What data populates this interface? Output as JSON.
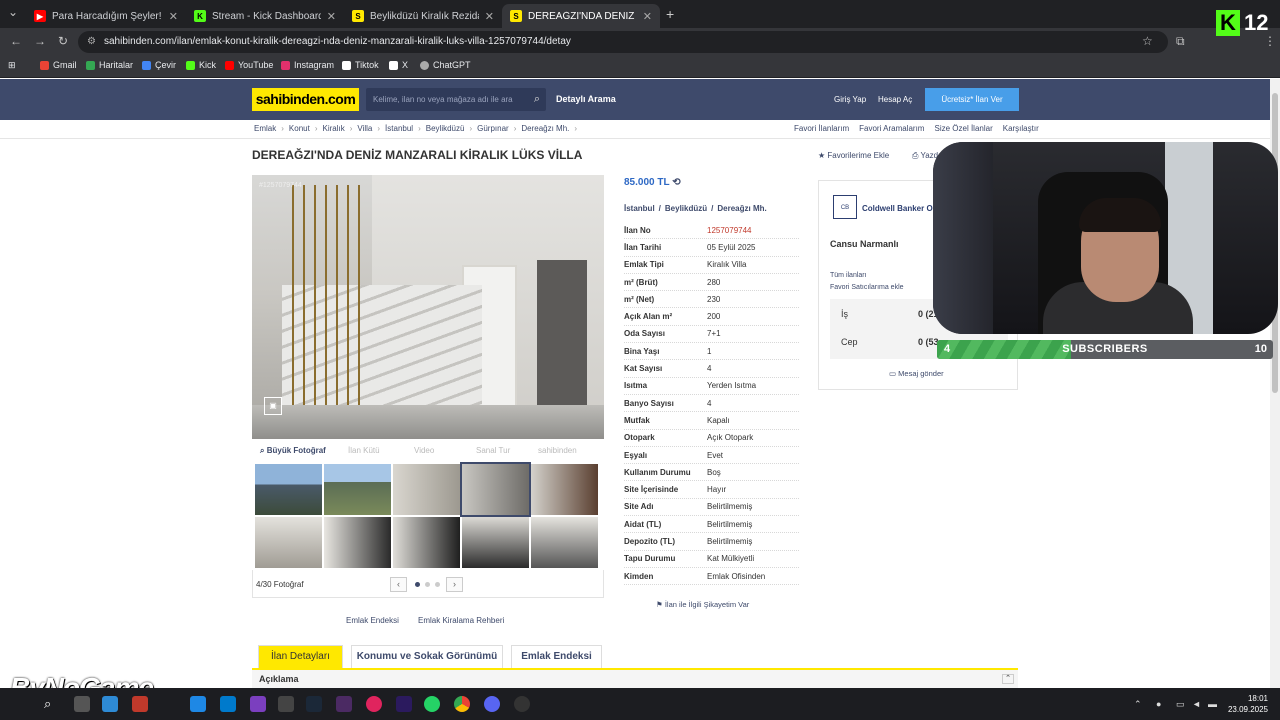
{
  "browser": {
    "tabs": [
      {
        "title": "Para Harcadığım Şeyler! (Kullan",
        "favicon_color": "#ff0000",
        "glyph": "▶"
      },
      {
        "title": "Stream - Kick Dashboard",
        "favicon_color": "#53fc18",
        "glyph": "K"
      },
      {
        "title": "Beylikdüzü Kiralık Rezidans, Vil",
        "favicon_color": "#ffe800",
        "glyph": "S"
      },
      {
        "title": "DEREAĞZI'NDA DENİZ MANZAR",
        "favicon_color": "#ffe800",
        "glyph": "S"
      }
    ],
    "new_tab": "+",
    "url": "sahibinden.com/ilan/emlak-konut-kiralik-dereagzi-nda-deniz-manzarali-kiralik-luks-villa-1257079744/detay",
    "bookmarks": [
      {
        "label": "Gmail",
        "color": "#ea4335"
      },
      {
        "label": "Haritalar",
        "color": "#34a853"
      },
      {
        "label": "Çevir",
        "color": "#4285f4"
      },
      {
        "label": "Kick",
        "color": "#53fc18"
      },
      {
        "label": "YouTube",
        "color": "#ff0000"
      },
      {
        "label": "Instagram",
        "color": "#e1306c"
      },
      {
        "label": "Tiktok",
        "color": "#ffffff"
      },
      {
        "label": "X",
        "color": "#ffffff"
      },
      {
        "label": "ChatGPT",
        "color": "#aaaaaa"
      }
    ]
  },
  "site": {
    "logo": "sahibinden.com",
    "search_placeholder": "Kelime, ilan no veya mağaza adı ile ara",
    "detayli": "Detaylı Arama",
    "login": "Giriş Yap",
    "register": "Hesap Aç",
    "post_ad": "Ücretsiz* İlan Ver",
    "breadcrumb": [
      "Emlak",
      "Konut",
      "Kiralık",
      "Villa",
      "İstanbul",
      "Beylikdüzü",
      "Gürpınar",
      "Dereağzı Mh."
    ],
    "top_links": [
      "Favori İlanlarım",
      "Favori Aramalarım",
      "Size Özel İlanlar",
      "Karşılaştır"
    ]
  },
  "listing": {
    "title": "DEREAĞZI'NDA DENİZ MANZARALI KİRALIK LÜKS VİLLA",
    "fav": "★ Favorilerime Ekle",
    "print": "Yazdır",
    "photo_id": "#1257079744",
    "media": [
      "Büyük Fotoğraf",
      "İlan Kütü",
      "Video",
      "Sanal Tur",
      "sahibinden"
    ],
    "photo_count": "4/30 Fotoğraf",
    "price": "85.000 TL",
    "location": [
      "İstanbul",
      "/",
      "Beylikdüzü",
      "/",
      "Dereağzı Mh."
    ],
    "details": [
      {
        "k": "İlan No",
        "v": "1257079744"
      },
      {
        "k": "İlan Tarihi",
        "v": "05 Eylül 2025"
      },
      {
        "k": "Emlak Tipi",
        "v": "Kiralık Villa"
      },
      {
        "k": "m² (Brüt)",
        "v": "280"
      },
      {
        "k": "m² (Net)",
        "v": "230"
      },
      {
        "k": "Açık Alan m²",
        "v": "200"
      },
      {
        "k": "Oda Sayısı",
        "v": "7+1"
      },
      {
        "k": "Bina Yaşı",
        "v": "1"
      },
      {
        "k": "Kat Sayısı",
        "v": "4"
      },
      {
        "k": "Isıtma",
        "v": "Yerden Isıtma"
      },
      {
        "k": "Banyo Sayısı",
        "v": "4"
      },
      {
        "k": "Mutfak",
        "v": "Kapalı"
      },
      {
        "k": "Otopark",
        "v": "Açık Otopark"
      },
      {
        "k": "Eşyalı",
        "v": "Evet"
      },
      {
        "k": "Kullanım Durumu",
        "v": "Boş"
      },
      {
        "k": "Site İçerisinde",
        "v": "Hayır"
      },
      {
        "k": "Site Adı",
        "v": "Belirtilmemiş"
      },
      {
        "k": "Aidat (TL)",
        "v": "Belirtilmemiş"
      },
      {
        "k": "Depozito (TL)",
        "v": "Belirtilmemiş"
      },
      {
        "k": "Tapu Durumu",
        "v": "Kat Mülkiyetli"
      },
      {
        "k": "Kimden",
        "v": "Emlak Ofisinden"
      }
    ],
    "complaint": "İlan ile İlgili Şikayetim Var",
    "emlak_endeksi": "Emlak Endeksi",
    "kiralama_rehberi": "Emlak Kiralama Rehberi"
  },
  "seller": {
    "logo": "CB",
    "office": "Coldwell Banker O",
    "agent": "Cansu Narmanlı",
    "all_ads": "Tüm ilanları",
    "fav_seller": "Favori Satıcılarıma ekle",
    "phones": [
      {
        "label": "İş",
        "num": "0 (21"
      },
      {
        "label": "Cep",
        "num": "0 (53"
      }
    ],
    "message": "Mesaj gönder"
  },
  "bottom_tabs": [
    "İlan Detayları",
    "Konumu ve Sokak Görünümü",
    "Emlak Endeksi"
  ],
  "aciklama": "Açıklama",
  "overlay": {
    "kick_logo": "K",
    "kick_count": "12",
    "subs_left": "4",
    "subs_label": "SUBSCRIBERS",
    "subs_right": "10",
    "subs_progress": 0.4,
    "watermark": "ByNoGame"
  },
  "taskbar": {
    "time": "18:01",
    "date": "23.09.2025"
  }
}
